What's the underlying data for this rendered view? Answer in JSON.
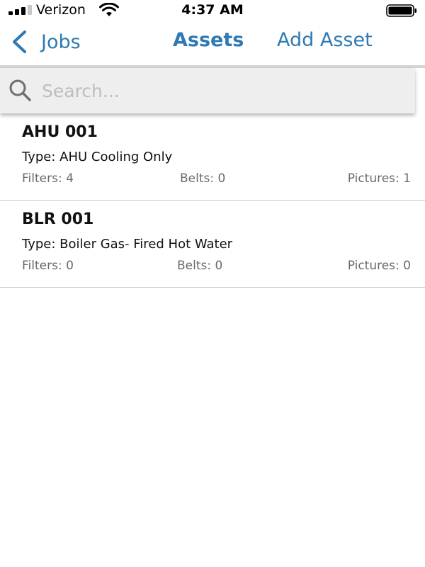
{
  "status_bar": {
    "carrier": "Verizon",
    "time": "4:37 AM",
    "signal_icon": "cellular-signal-icon",
    "wifi_icon": "wifi-icon",
    "battery_icon": "battery-icon"
  },
  "nav": {
    "back_label": "Jobs",
    "title": "Assets",
    "add_label": "Add Asset",
    "accent_color": "#2d7ab4"
  },
  "search": {
    "placeholder": "Search...",
    "value": ""
  },
  "assets": [
    {
      "name": "AHU 001",
      "type": "Type: AHU Cooling Only",
      "filters": "Filters: 4",
      "belts": "Belts: 0",
      "pictures": "Pictures: 1"
    },
    {
      "name": "BLR 001",
      "type": "Type: Boiler Gas- Fired Hot Water",
      "filters": "Filters: 0",
      "belts": "Belts: 0",
      "pictures": "Pictures: 0"
    }
  ]
}
